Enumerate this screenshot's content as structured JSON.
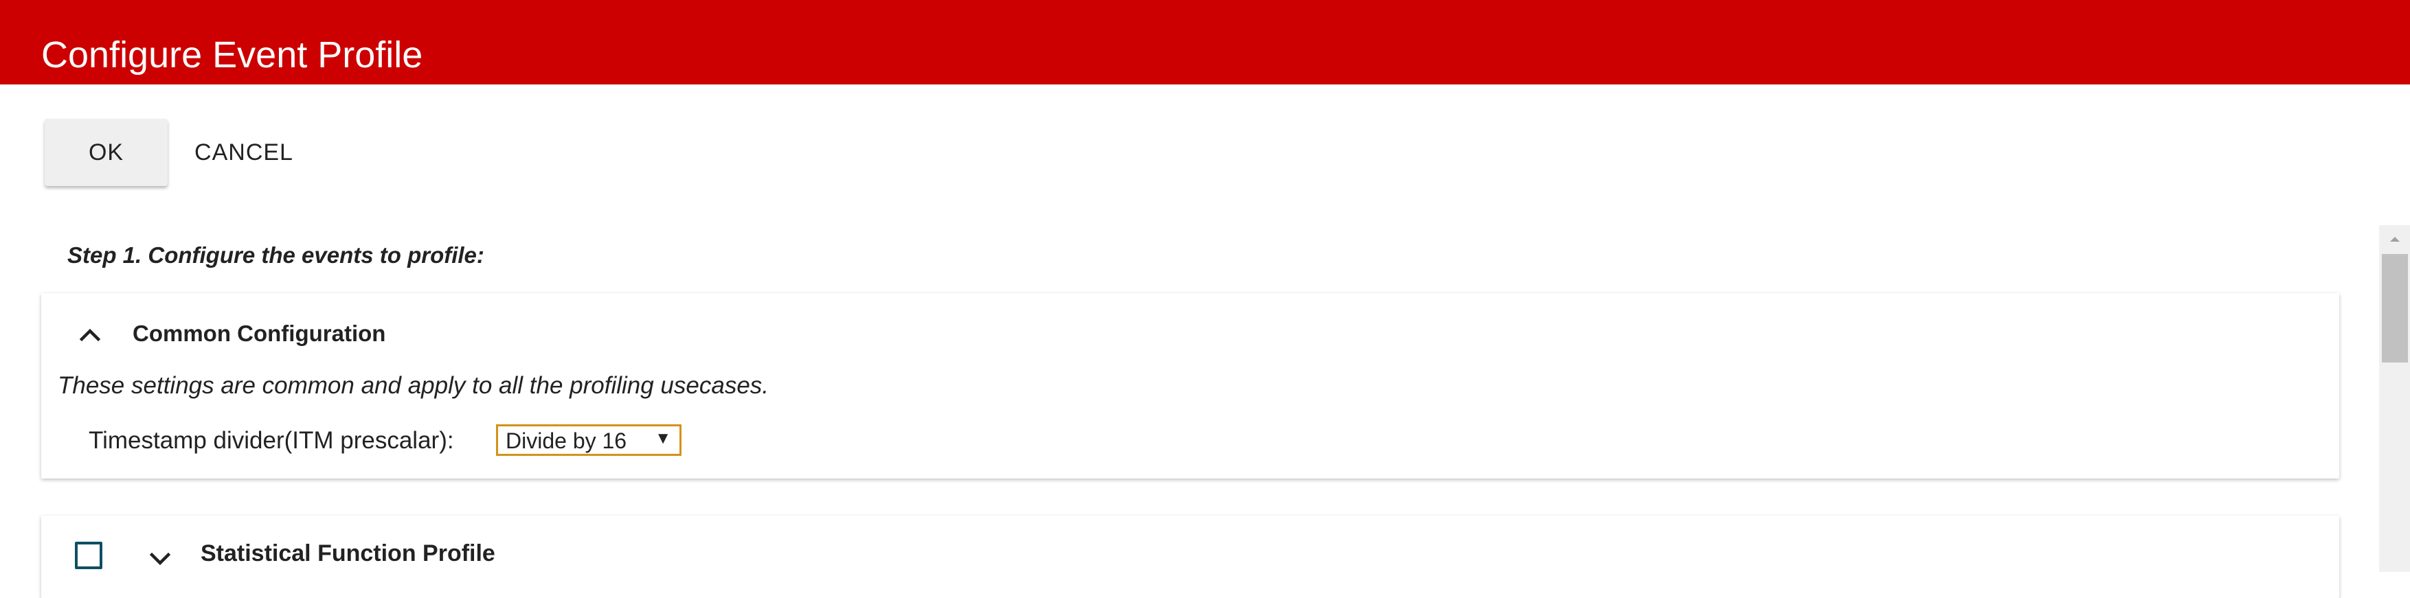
{
  "header": {
    "title": "Configure Event Profile"
  },
  "toolbar": {
    "ok_label": "OK",
    "cancel_label": "CANCEL"
  },
  "step": {
    "title": "Step 1. Configure the events to profile:"
  },
  "common_config": {
    "title": "Common Configuration",
    "expanded": true,
    "description": "These settings are common and apply to all the profiling usecases.",
    "timestamp_label": "Timestamp divider(ITM prescalar):",
    "timestamp_value": "Divide by 16"
  },
  "statistical_profile": {
    "title": "Statistical Function Profile",
    "checked": false,
    "expanded": false
  },
  "icons": {
    "common_chevron": "chevron-up-icon",
    "statistical_chevron": "chevron-down-icon",
    "scroll_up": "arrow-up-icon"
  },
  "colors": {
    "header_bg": "#cc0000",
    "select_border": "#d4921a",
    "checkbox_border": "#0d4f63"
  }
}
